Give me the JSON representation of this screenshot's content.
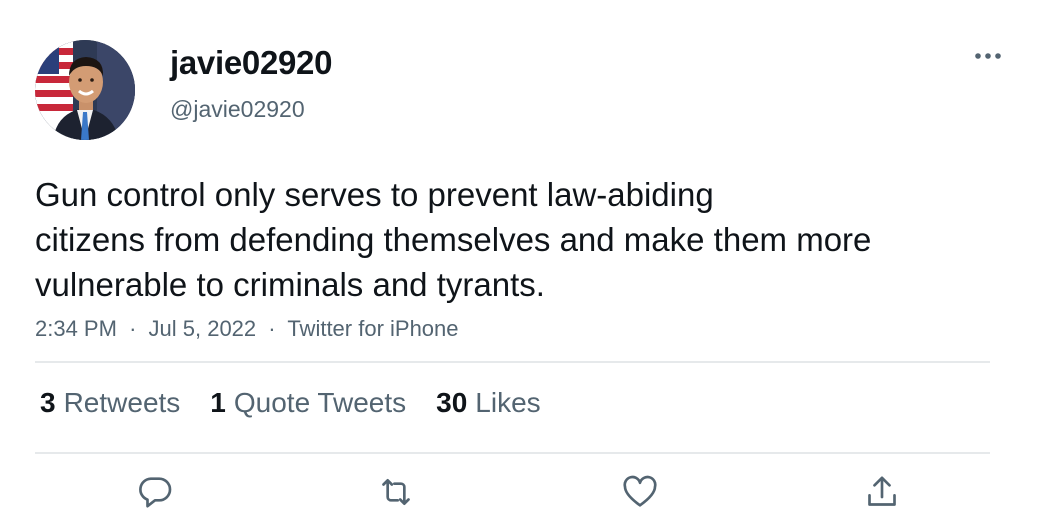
{
  "tweet": {
    "display_name": "javie02920",
    "handle": "@javie02920",
    "text_lines": [
      "Gun control only serves to prevent law-abiding",
      "citizens from defending themselves and make them more",
      "vulnerable to criminals and tyrants."
    ],
    "time": "2:34 PM",
    "date": "Jul 5, 2022",
    "source": "Twitter for iPhone",
    "separator": "·",
    "stats": {
      "retweets_count": "3",
      "retweets_label": "Retweets",
      "quotes_count": "1",
      "quotes_label": "Quote Tweets",
      "likes_count": "30",
      "likes_label": "Likes"
    }
  },
  "icons": {
    "more": "more-options-icon",
    "reply": "reply-icon",
    "retweet": "retweet-icon",
    "like": "like-icon",
    "share": "share-icon"
  },
  "colors": {
    "text": "#0f1419",
    "secondary": "#536471",
    "divider": "#e6e9eb",
    "background": "#ffffff"
  }
}
